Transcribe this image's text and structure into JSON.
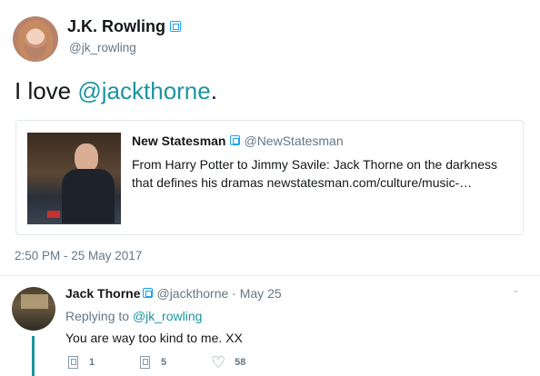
{
  "tweet": {
    "author_name": "J.K. Rowling",
    "author_handle": "@jk_rowling",
    "text_prefix": "I love ",
    "text_mention": "@jackthorne",
    "text_suffix": ".",
    "timestamp": "2:50 PM - 25 May 2017"
  },
  "quote": {
    "name": "New Statesman",
    "handle": "@NewStatesman",
    "text": "From Harry Potter to Jimmy Savile: Jack Thorne on the darkness that defines his dramas newstatesman.com/culture/music-…"
  },
  "reply": {
    "name": "Jack Thorne",
    "meta": "@jackthorne · May 25",
    "replying_prefix": "Replying to ",
    "replying_mention": "@jk_rowling",
    "text": "You are way too kind to me. XX",
    "actions": {
      "reply_count": "1",
      "retweet_count": "5",
      "like_count": "58"
    }
  },
  "icons": {
    "verified": "verified-badge-icon",
    "reply": "reply-icon",
    "retweet": "retweet-icon",
    "like": "heart-icon"
  },
  "colors": {
    "mention": "#1b95a0",
    "secondary_text": "#657786",
    "border": "#e1e8ed"
  }
}
